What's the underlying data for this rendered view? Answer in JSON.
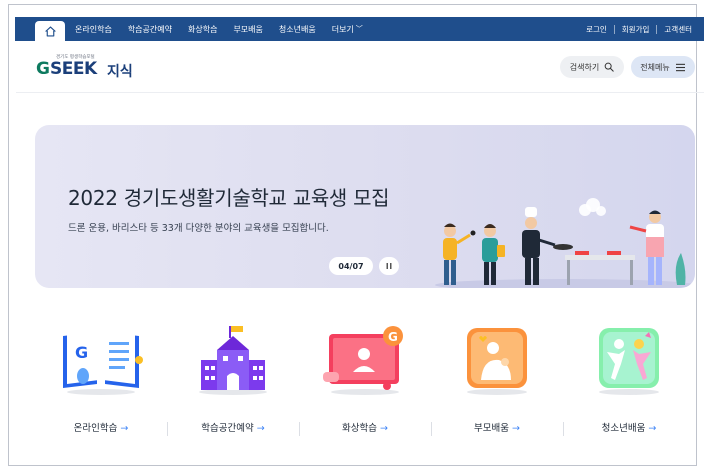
{
  "topnav": {
    "items": [
      {
        "label": "온라인학습"
      },
      {
        "label": "학습공간예약"
      },
      {
        "label": "화상학습"
      },
      {
        "label": "부모배움"
      },
      {
        "label": "청소년배움"
      },
      {
        "label": "더보기"
      }
    ],
    "util": [
      {
        "label": "로그인"
      },
      {
        "label": "회원가입"
      },
      {
        "label": "고객센터"
      }
    ]
  },
  "header": {
    "logo_small": "경기도 평생학습포털",
    "logo_g": "G",
    "logo_seek": "SEEK",
    "logo_jisik": "지식",
    "search_label": "검색하기",
    "menu_label": "전체메뉴"
  },
  "banner": {
    "title": "2022 경기도생활기술학교 교육생 모집",
    "description": "드론 운용, 바리스타 등 33개 다양한 분야의 교육생을 모집합니다.",
    "pager": "04/07"
  },
  "quick": [
    {
      "label": "온라인학습",
      "arrow": "→"
    },
    {
      "label": "학습공간예약",
      "arrow": "→"
    },
    {
      "label": "화상학습",
      "arrow": "→"
    },
    {
      "label": "부모배움",
      "arrow": "→"
    },
    {
      "label": "청소년배움",
      "arrow": "→"
    }
  ],
  "colors": {
    "nav_bg": "#1f4e8c",
    "banner_bg": "#dcdcef",
    "accent": "#3b82f6",
    "logo_green": "#0d7a5f",
    "logo_navy": "#1b3f7a"
  },
  "icons": {
    "home": "home-icon",
    "search": "search-icon",
    "menu": "hamburger-icon",
    "pause": "pause-icon"
  }
}
